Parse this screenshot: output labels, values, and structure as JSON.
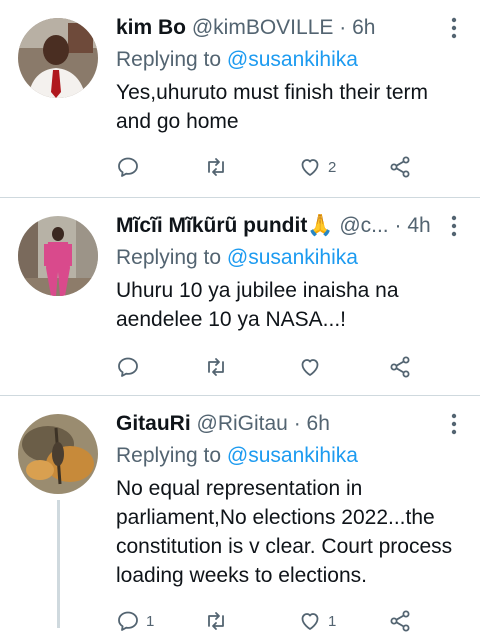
{
  "tweets": [
    {
      "name": "kim Bo",
      "handle": "@kimBOVILLE",
      "time": "6h",
      "replying_prefix": "Replying to",
      "replying_to": "@susankihika",
      "text": "Yes,uhuruto must finish their term and go home",
      "likes": "2",
      "replies": "",
      "retweets": ""
    },
    {
      "name": "Mĩcĩi Mĩkũrũ pundit🙏",
      "handle": "@c...",
      "time": "4h",
      "replying_prefix": "Replying to",
      "replying_to": "@susankihika",
      "text": "Uhuru 10 ya jubilee inaisha na aendelee 10 ya NASA...!",
      "likes": "",
      "replies": "",
      "retweets": ""
    },
    {
      "name": "GitauRi",
      "handle": "@RiGitau",
      "time": "6h",
      "replying_prefix": "Replying to",
      "replying_to": "@susankihika",
      "text": "No equal representation in parliament,No elections 2022...the constitution is v clear. Court process loading weeks to elections.",
      "likes": "1",
      "replies": "1",
      "retweets": ""
    }
  ],
  "separator": "·",
  "colors": {
    "text": "#0f1419",
    "secondary": "#536471",
    "link": "#1d9bf0",
    "divider": "#cfd9de"
  },
  "icons": [
    "reply-icon",
    "retweet-icon",
    "like-icon",
    "share-icon",
    "more-icon"
  ]
}
